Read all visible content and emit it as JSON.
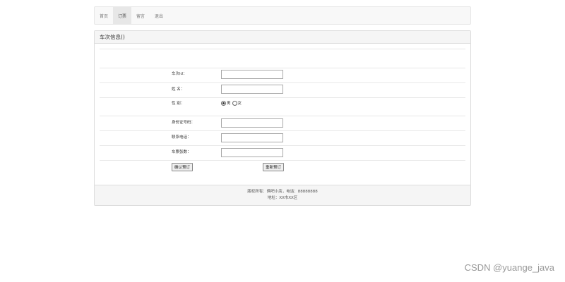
{
  "nav": {
    "items": [
      {
        "label": "首页",
        "active": false
      },
      {
        "label": "订票",
        "active": true
      },
      {
        "label": "留言",
        "active": false
      },
      {
        "label": "退出",
        "active": false
      }
    ]
  },
  "panel": {
    "title": "车次信息()"
  },
  "form": {
    "train_id_label": "车次id：",
    "train_id_value": "",
    "name_label": "姓  名：",
    "name_value": "",
    "gender_label": "性  别：",
    "gender_options": [
      "男",
      "女"
    ],
    "gender_selected": "男",
    "id_card_label": "身份证号码：",
    "id_card_value": "",
    "phone_label": "联系电话：",
    "phone_value": "",
    "ticket_count_label": "车票张数：",
    "ticket_count_value": "",
    "confirm_button": "确认预订",
    "reset_button": "重新预订"
  },
  "footer": {
    "line1": "版权所有：俩吧小店，电话：88888888",
    "line2": "地址：XX市XX区"
  },
  "watermark": "CSDN @yuange_java"
}
